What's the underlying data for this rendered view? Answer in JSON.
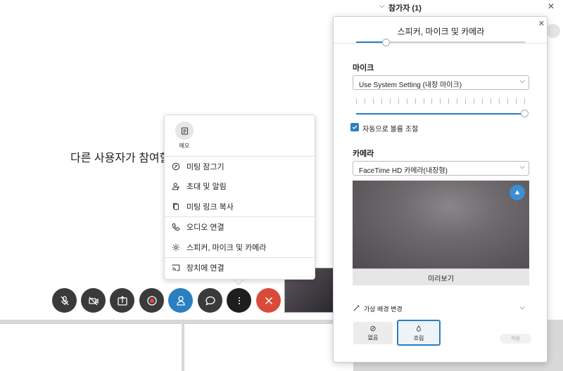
{
  "meeting": {
    "waiting_text": "다른 사용자가 참여할 때까지 기다리는 중",
    "participants_title": "참가자 (1)"
  },
  "controls": [
    {
      "name": "mute-button",
      "icon": "mic-off-icon"
    },
    {
      "name": "video-button",
      "icon": "camera-off-icon"
    },
    {
      "name": "share-button",
      "icon": "share-icon"
    },
    {
      "name": "record-button",
      "icon": "record-icon"
    },
    {
      "name": "participants-button",
      "icon": "person-icon"
    },
    {
      "name": "chat-button",
      "icon": "chat-icon"
    },
    {
      "name": "more-options-button",
      "icon": "more-icon"
    },
    {
      "name": "leave-button",
      "icon": "close-icon"
    }
  ],
  "menu": {
    "memo_label": "메모",
    "items": [
      {
        "label": "미팅 잠그기",
        "icon": "lock-icon"
      },
      {
        "label": "초대 및 알림",
        "icon": "invite-person-icon"
      },
      {
        "label": "미팅 링크 복사",
        "icon": "copy-icon"
      },
      {
        "label": "오디오 연결",
        "icon": "phone-icon"
      },
      {
        "label": "스피커, 마이크 및 카메라",
        "icon": "gear-icon"
      },
      {
        "label": "장치에 연결",
        "icon": "cast-icon"
      }
    ]
  },
  "panel": {
    "title": "스피커, 마이크 및 카메라",
    "speaker_volume": 0.18,
    "mic_label": "마이크",
    "mic_selected": "Use System Setting (내장 마이크)",
    "mic_volume": 1.0,
    "auto_volume_label": "자동으로 볼륨 조절",
    "auto_volume_checked": true,
    "camera_label": "카메라",
    "camera_selected": "FaceTime HD 카메라(내장형)",
    "preview_label": "미리보기",
    "virtual_bg_label": "가상 배경 변경",
    "bg_none_label": "없음",
    "bg_blur_label": "흐림",
    "apply_label": "적용"
  },
  "colors": {
    "accent": "#2a7fc0",
    "leave": "#d94a3a",
    "control_dark": "#3a3a3a"
  }
}
